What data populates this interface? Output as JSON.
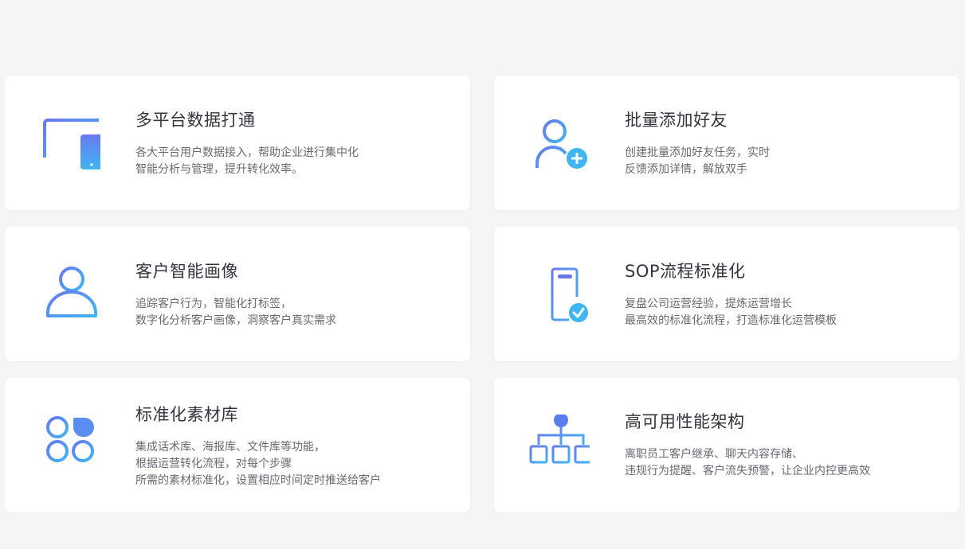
{
  "features": [
    {
      "title": "多平台数据打通",
      "icon": "devices-icon",
      "lines": [
        "各大平台用户数据接入，帮助企业进行集中化",
        "智能分析与管理，提升转化效率。"
      ]
    },
    {
      "title": "批量添加好友",
      "icon": "add-user-icon",
      "lines": [
        "创建批量添加好友任务，实时",
        "反馈添加详情，解放双手"
      ]
    },
    {
      "title": "客户智能画像",
      "icon": "user-icon",
      "lines": [
        "追踪客户行为，智能化打标签，",
        "数字化分析客户画像，洞察客户真实需求"
      ]
    },
    {
      "title": "SOP流程标准化",
      "icon": "document-check-icon",
      "lines": [
        "复盘公司运营经验，提炼运营增长",
        "最高效的标准化流程，打造标准化运营模板"
      ]
    },
    {
      "title": "标准化素材库",
      "icon": "apps-icon",
      "lines": [
        "集成话术库、海报库、文件库等功能，",
        "根据运营转化流程，对每个步骤",
        "所需的素材标准化，设置相应时间定时推送给客户"
      ]
    },
    {
      "title": "高可用性能架构",
      "icon": "hierarchy-icon",
      "lines": [
        "离职员工客户继承、聊天内容存储、",
        "违规行为提醒、客户流失预警，让企业内控更高效"
      ]
    }
  ],
  "colors": {
    "gradient_start": "#5b7cf0",
    "gradient_end": "#3cb8f0"
  }
}
